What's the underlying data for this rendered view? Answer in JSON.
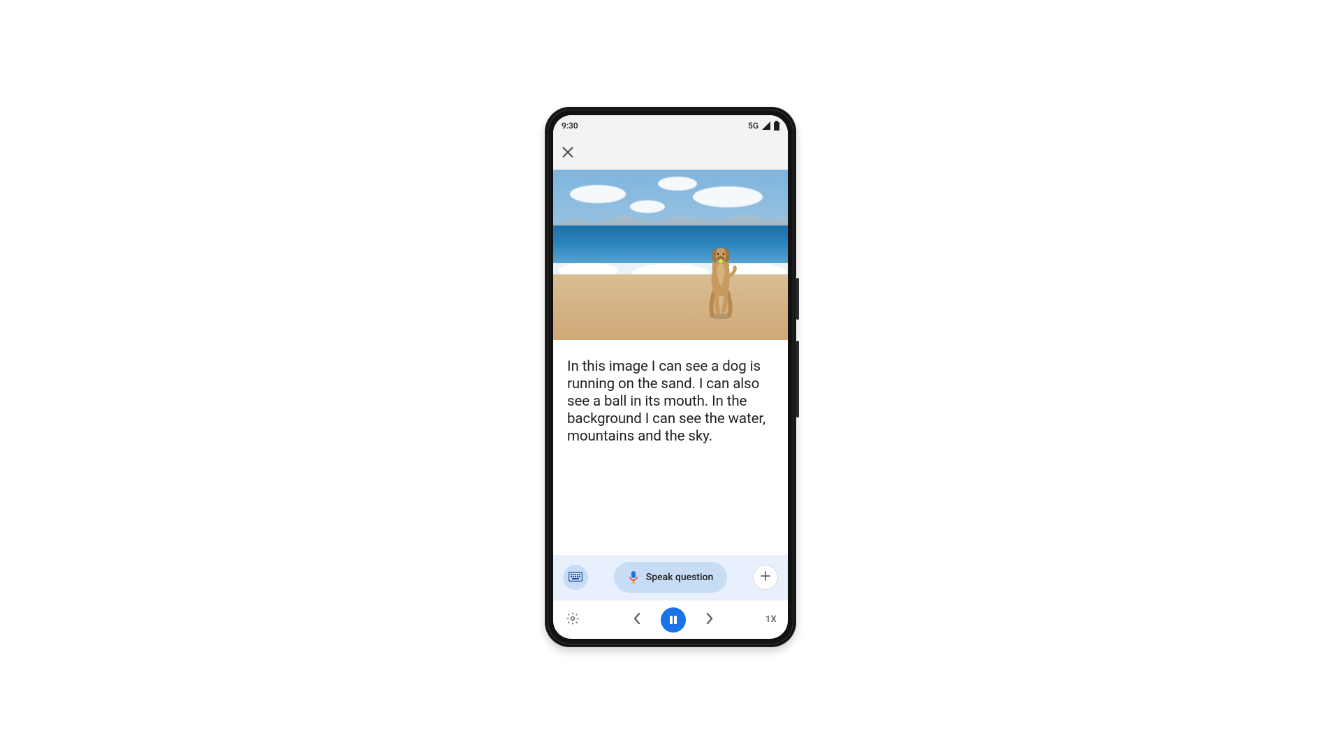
{
  "statusbar": {
    "time": "9:30",
    "network": "5G"
  },
  "caption": {
    "text": "In this image I can see a dog is running on the sand. I can also see a ball in its mouth. In the background I can see the water, mountains and the sky."
  },
  "actionbar": {
    "speak_label": "Speak question"
  },
  "playback": {
    "speed_label": "1X"
  },
  "image": {
    "alt": "dog running on beach with ball in mouth"
  },
  "colors": {
    "accent": "#1a73e8",
    "chip": "#c7ddf6",
    "panel": "#e8f0fe"
  }
}
